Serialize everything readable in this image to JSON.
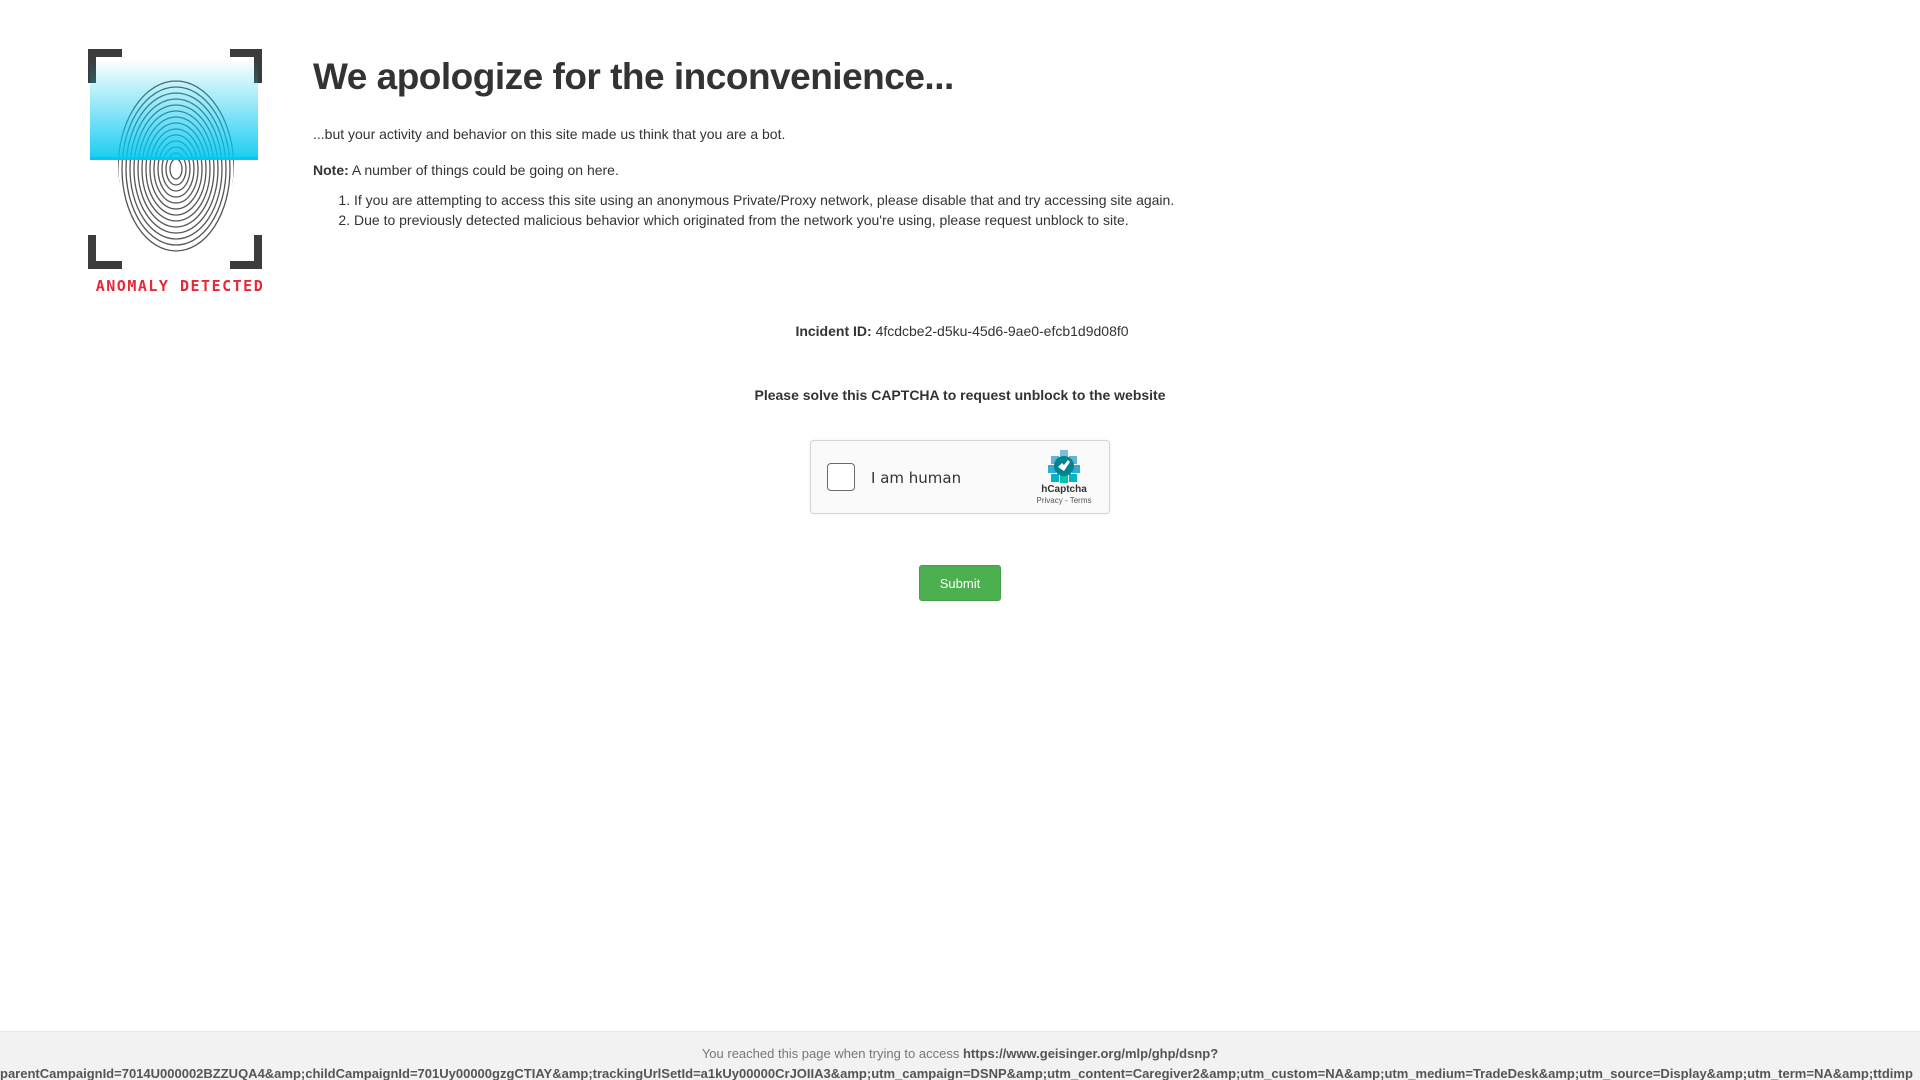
{
  "logo": {
    "icon": "fingerprint-scan-icon",
    "caption": "ANOMALY DETECTED",
    "caption_color": "#e8283a",
    "accent_color": "#00c8f0"
  },
  "main": {
    "headline": "We apologize for the inconvenience...",
    "lead": "...but your activity and behavior on this site made us think that you are a bot.",
    "note_label": "Note:",
    "note_text": " A number of things could be going on here.",
    "reasons": [
      "If you are attempting to access this site using an anonymous Private/Proxy network, please disable that and try accessing site again.",
      "Due to previously detected malicious behavior which originated from the network you're using, please request unblock to site."
    ]
  },
  "incident": {
    "label": "Incident ID:",
    "value": "4fcdcbe2-d5ku-45d6-9ae0-efcb1d9d08f0"
  },
  "captcha": {
    "prompt": "Please solve this CAPTCHA to request unblock to the website",
    "checkbox_label": "I am human",
    "brand_name": "hCaptcha",
    "privacy_link": "Privacy",
    "separator": " - ",
    "terms_link": "Terms",
    "checked": false
  },
  "submit": {
    "label": "Submit",
    "color": "#4caf50"
  },
  "footer": {
    "prefix": "You reached this page when trying to access ",
    "url_line1": "https://www.geisinger.org/mlp/ghp/dsnp?",
    "url_line2": "parentCampaignId=7014U000002BZZUQA4&amp;childCampaignId=701Uy00000gzgCTIAY&amp;trackingUrlSetId=a1kUy00000CrJOIIA3&amp;utm_campaign=DSNP&amp;utm_content=Caregiver2&amp;utm_custom=NA&amp;utm_medium=TradeDesk&amp;utm_source=Display&amp;utm_term=NA&amp;ttdimp"
  }
}
